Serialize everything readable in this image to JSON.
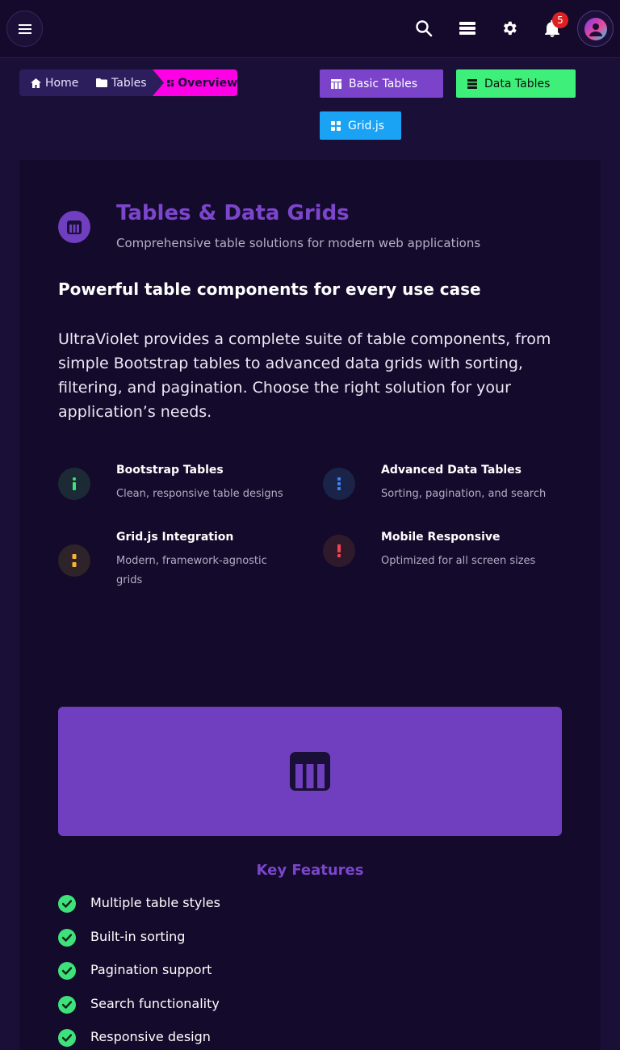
{
  "topbar": {
    "menu_icon": "hamburger-icon",
    "icons": [
      "search-icon",
      "stack-icon",
      "gear-icon",
      "bell-icon"
    ],
    "notification_count": "5",
    "avatar_icon": "user-avatar-icon"
  },
  "breadcrumb": {
    "home": "Home",
    "tables": "Tables",
    "overview": "Overview"
  },
  "actions": {
    "basic_tables": "Basic Tables",
    "data_tables": "Data Tables",
    "gridjs": "Grid.js"
  },
  "hero": {
    "title": "Tables & Data Grids",
    "subtitle": "Comprehensive table solutions for modern web applications"
  },
  "section": {
    "heading": "Powerful table components for every use case",
    "intro": "UltraViolet provides a complete suite of table components, from simple Bootstrap tables to advanced data grids with sorting, filtering, and pagination. Choose the right solution for your application’s needs."
  },
  "features": [
    {
      "title": "Bootstrap Tables",
      "desc": "Clean, responsive table designs",
      "color": "#3ee27a"
    },
    {
      "title": "Advanced Data Tables",
      "desc": "Sorting, pagination, and search",
      "color": "#3b82f6"
    },
    {
      "title": "Grid.js Integration",
      "desc": "Modern, framework-agnostic grids",
      "color": "#f5b52e"
    },
    {
      "title": "Mobile Responsive",
      "desc": "Optimized for all screen sizes",
      "color": "#ef4452"
    }
  ],
  "key_features": {
    "title": "Key Features",
    "items": [
      "Multiple table styles",
      "Built-in sorting",
      "Pagination support",
      "Search functionality",
      "Responsive design"
    ]
  },
  "colors": {
    "accent": "#7b46cc",
    "background": "#1a0f36",
    "card": "#140a2b",
    "breadcrumb_active": "#ff00e6",
    "btn_basic": "#7a43c9",
    "btn_data": "#3ef07a",
    "btn_grid": "#1aa2f5",
    "badge": "#e02020"
  }
}
